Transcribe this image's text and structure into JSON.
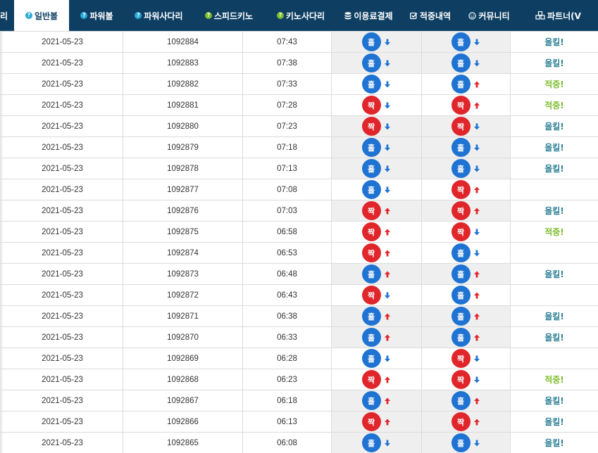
{
  "nav": {
    "items": [
      {
        "label": "리",
        "icon": "",
        "active": false
      },
      {
        "label": "일반볼",
        "icon": "question-circle-icon",
        "active": true
      },
      {
        "label": "파워볼",
        "icon": "question-circle-icon",
        "active": false
      },
      {
        "label": "파워사다리",
        "icon": "question-circle-icon",
        "active": false
      },
      {
        "label": "스피드키노",
        "icon": "question-circle-icon",
        "active": false
      },
      {
        "label": "키노사다리",
        "icon": "question-circle-icon",
        "active": false
      },
      {
        "label": "이용료결제",
        "icon": "database-icon",
        "active": false
      },
      {
        "label": "적중내역",
        "icon": "checkbox-icon",
        "active": false
      },
      {
        "label": "커뮤니티",
        "icon": "smiley-icon",
        "active": false
      },
      {
        "label": "파트너(V",
        "icon": "cubes-icon",
        "active": false
      }
    ]
  },
  "colors": {
    "navbar": "#0e3f63",
    "odd_ball": "#1f73d2",
    "even_ball": "#e0262b",
    "arrow_up": "#e0262b",
    "arrow_down": "#1f73d2",
    "miss_text": "#2d7f95",
    "hit_text": "#7cbd2b"
  },
  "labels": {
    "odd": "홀",
    "even": "짝",
    "miss": "올킬!",
    "hit": "적중!"
  },
  "rows": [
    {
      "date": "2021-05-23",
      "round": "1092884",
      "time": "07:43",
      "a": "odd",
      "a_dir": "down",
      "a_dark": true,
      "b": "odd",
      "b_dir": "down",
      "b_dark": true,
      "outcome": "miss"
    },
    {
      "date": "2021-05-23",
      "round": "1092883",
      "time": "07:38",
      "a": "odd",
      "a_dir": "down",
      "a_dark": true,
      "b": "odd",
      "b_dir": "down",
      "b_dark": true,
      "outcome": "miss"
    },
    {
      "date": "2021-05-23",
      "round": "1092882",
      "time": "07:33",
      "a": "odd",
      "a_dir": "down",
      "a_dark": false,
      "b": "odd",
      "b_dir": "up",
      "b_dark": false,
      "outcome": "hit"
    },
    {
      "date": "2021-05-23",
      "round": "1092881",
      "time": "07:28",
      "a": "even",
      "a_dir": "down",
      "a_dark": false,
      "b": "even",
      "b_dir": "up",
      "b_dark": false,
      "outcome": "hit"
    },
    {
      "date": "2021-05-23",
      "round": "1092880",
      "time": "07:23",
      "a": "even",
      "a_dir": "down",
      "a_dark": true,
      "b": "even",
      "b_dir": "down",
      "b_dark": true,
      "outcome": "miss"
    },
    {
      "date": "2021-05-23",
      "round": "1092879",
      "time": "07:18",
      "a": "odd",
      "a_dir": "down",
      "a_dark": true,
      "b": "odd",
      "b_dir": "down",
      "b_dark": true,
      "outcome": "miss"
    },
    {
      "date": "2021-05-23",
      "round": "1092878",
      "time": "07:13",
      "a": "odd",
      "a_dir": "down",
      "a_dark": true,
      "b": "odd",
      "b_dir": "down",
      "b_dark": true,
      "outcome": "miss"
    },
    {
      "date": "2021-05-23",
      "round": "1092877",
      "time": "07:08",
      "a": "odd",
      "a_dir": "down",
      "a_dark": false,
      "b": "even",
      "b_dir": "up",
      "b_dark": false,
      "outcome": ""
    },
    {
      "date": "2021-05-23",
      "round": "1092876",
      "time": "07:03",
      "a": "even",
      "a_dir": "up",
      "a_dark": true,
      "b": "even",
      "b_dir": "up",
      "b_dark": true,
      "outcome": "miss"
    },
    {
      "date": "2021-05-23",
      "round": "1092875",
      "time": "06:58",
      "a": "even",
      "a_dir": "up",
      "a_dark": false,
      "b": "even",
      "b_dir": "down",
      "b_dark": false,
      "outcome": "hit"
    },
    {
      "date": "2021-05-23",
      "round": "1092874",
      "time": "06:53",
      "a": "even",
      "a_dir": "up",
      "a_dark": false,
      "b": "odd",
      "b_dir": "down",
      "b_dark": false,
      "outcome": ""
    },
    {
      "date": "2021-05-23",
      "round": "1092873",
      "time": "06:48",
      "a": "odd",
      "a_dir": "up",
      "a_dark": true,
      "b": "odd",
      "b_dir": "up",
      "b_dark": true,
      "outcome": "miss"
    },
    {
      "date": "2021-05-23",
      "round": "1092872",
      "time": "06:43",
      "a": "even",
      "a_dir": "down",
      "a_dark": false,
      "b": "odd",
      "b_dir": "up",
      "b_dark": false,
      "outcome": ""
    },
    {
      "date": "2021-05-23",
      "round": "1092871",
      "time": "06:38",
      "a": "odd",
      "a_dir": "up",
      "a_dark": true,
      "b": "odd",
      "b_dir": "up",
      "b_dark": true,
      "outcome": "miss"
    },
    {
      "date": "2021-05-23",
      "round": "1092870",
      "time": "06:33",
      "a": "odd",
      "a_dir": "up",
      "a_dark": true,
      "b": "odd",
      "b_dir": "up",
      "b_dark": true,
      "outcome": "miss"
    },
    {
      "date": "2021-05-23",
      "round": "1092869",
      "time": "06:28",
      "a": "odd",
      "a_dir": "down",
      "a_dark": false,
      "b": "even",
      "b_dir": "down",
      "b_dark": false,
      "outcome": ""
    },
    {
      "date": "2021-05-23",
      "round": "1092868",
      "time": "06:23",
      "a": "even",
      "a_dir": "up",
      "a_dark": false,
      "b": "even",
      "b_dir": "down",
      "b_dark": false,
      "outcome": "hit"
    },
    {
      "date": "2021-05-23",
      "round": "1092867",
      "time": "06:18",
      "a": "odd",
      "a_dir": "up",
      "a_dark": true,
      "b": "odd",
      "b_dir": "up",
      "b_dark": true,
      "outcome": "miss"
    },
    {
      "date": "2021-05-23",
      "round": "1092866",
      "time": "06:13",
      "a": "even",
      "a_dir": "up",
      "a_dark": true,
      "b": "even",
      "b_dir": "up",
      "b_dark": true,
      "outcome": "miss"
    },
    {
      "date": "2021-05-23",
      "round": "1092865",
      "time": "06:08",
      "a": "odd",
      "a_dir": "down",
      "a_dark": true,
      "b": "odd",
      "b_dir": "down",
      "b_dark": true,
      "outcome": "miss"
    }
  ]
}
